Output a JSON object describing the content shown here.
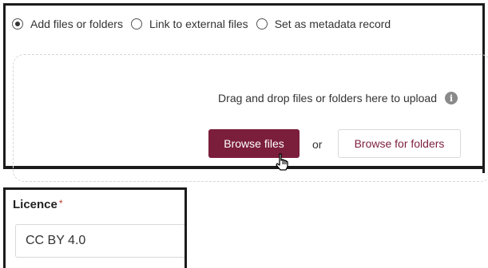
{
  "upload": {
    "options": [
      {
        "label": "Add files or folders",
        "selected": true
      },
      {
        "label": "Link to external files",
        "selected": false
      },
      {
        "label": "Set as metadata record",
        "selected": false
      }
    ],
    "drop_text": "Drag and drop files or folders here to upload",
    "info_icon": "info-icon",
    "browse_files_label": "Browse files",
    "or_text": "or",
    "browse_folders_label": "Browse for folders"
  },
  "licence": {
    "label": "Licence",
    "required_marker": "*",
    "value": "CC BY 4.0"
  },
  "colors": {
    "primary": "#7b1e3c",
    "required": "#c0392b"
  }
}
